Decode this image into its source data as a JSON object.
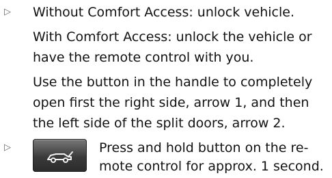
{
  "bullets": {
    "marker": "▷"
  },
  "lines": [
    "Without Comfort Access: unlock vehicle.",
    "With Comfort Access: unlock the vehicle or",
    "have the remote control with you.",
    "Use the button in the handle to completely",
    "open first the right side, arrow 1, and then",
    "the left side of the split doors, arrow 2.",
    "Press and hold button on the re-",
    "mote control for approx. 1 second."
  ],
  "icon": {
    "name": "tailgate-car-icon"
  }
}
